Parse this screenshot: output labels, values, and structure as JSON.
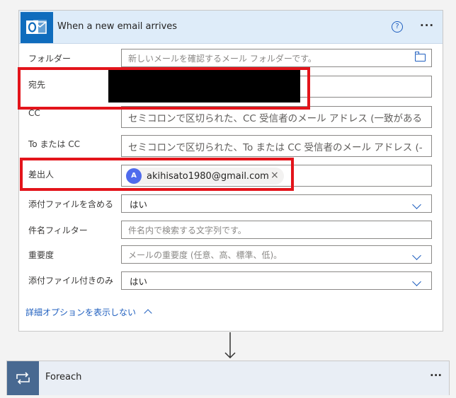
{
  "trigger": {
    "title": "When a new email arrives",
    "help_glyph": "?",
    "more_glyph": "···",
    "fields": {
      "folder": {
        "label": "フォルダー",
        "placeholder": "新しいメールを確認するメール フォルダーです。"
      },
      "to": {
        "label": "宛先",
        "value": ""
      },
      "cc": {
        "label": "CC",
        "placeholder": "セミコロンで区切られた、CC 受信者のメール アドレス (一致がある"
      },
      "to_or_cc": {
        "label": "To または CC",
        "placeholder": "セミコロンで区切られた、To または CC 受信者のメール アドレス (-"
      },
      "from": {
        "label": "差出人",
        "token_avatar": "A",
        "token_text": "akihisato1980@gmail.com",
        "token_remove": "×"
      },
      "include_attachments": {
        "label": "添付ファイルを含める",
        "value": "はい"
      },
      "subject_filter": {
        "label": "件名フィルター",
        "placeholder": "件名内で検索する文字列です。"
      },
      "importance": {
        "label": "重要度",
        "placeholder": "メールの重要度 (任意、高、標準、低)。"
      },
      "only_with_attachments": {
        "label": "添付ファイル付きのみ",
        "value": "はい"
      }
    },
    "advanced_link": "詳細オプションを表示しない"
  },
  "foreach": {
    "title": "Foreach",
    "more_glyph": "···"
  },
  "colors": {
    "accent": "#1f5fbf",
    "highlight": "#e3141b",
    "outlook_blue": "#0f6cbd",
    "foreach_tile": "#486991"
  }
}
